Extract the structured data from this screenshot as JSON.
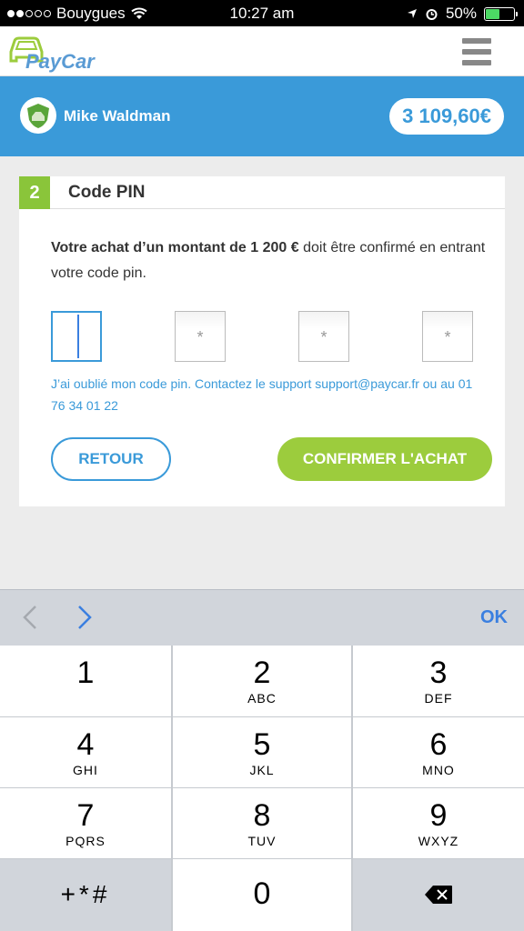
{
  "status_bar": {
    "carrier": "Bouygues",
    "time": "10:27 am",
    "battery": "50%"
  },
  "header": {
    "logo_text": "PayCar"
  },
  "user": {
    "name": "Mike Waldman",
    "balance": "3 109,60€"
  },
  "step": {
    "number": "2",
    "title": "Code PIN",
    "description_bold": "Votre achat d’un montant de 1 200 €",
    "description_rest": " doit être confirmé en entrant votre code pin.",
    "pin_placeholders": [
      "",
      "*",
      "*",
      "*"
    ],
    "forgot_text": "J’ai oublié mon code pin. Contactez le support support@paycar.fr ou au 01 76 34 01 22",
    "back_label": "RETOUR",
    "confirm_label": "CONFIRMER L'ACHAT"
  },
  "accessory": {
    "ok_label": "OK"
  },
  "keypad": {
    "keys": [
      {
        "num": "1",
        "letters": ""
      },
      {
        "num": "2",
        "letters": "ABC"
      },
      {
        "num": "3",
        "letters": "DEF"
      },
      {
        "num": "4",
        "letters": "GHI"
      },
      {
        "num": "5",
        "letters": "JKL"
      },
      {
        "num": "6",
        "letters": "MNO"
      },
      {
        "num": "7",
        "letters": "PQRS"
      },
      {
        "num": "8",
        "letters": "TUV"
      },
      {
        "num": "9",
        "letters": "WXYZ"
      },
      {
        "num": "+*#",
        "letters": ""
      },
      {
        "num": "0",
        "letters": ""
      },
      {
        "num": "",
        "letters": ""
      }
    ]
  },
  "colors": {
    "accent_blue": "#3a9ad9",
    "accent_green": "#9ccc3d",
    "step_green": "#8ac53a"
  },
  "icons": [
    "wifi-icon",
    "location-arrow-icon",
    "alarm-icon",
    "battery-icon",
    "paycar-car-icon",
    "menu-icon",
    "shield-avatar-icon",
    "chevron-left-icon",
    "chevron-right-icon",
    "backspace-icon"
  ]
}
